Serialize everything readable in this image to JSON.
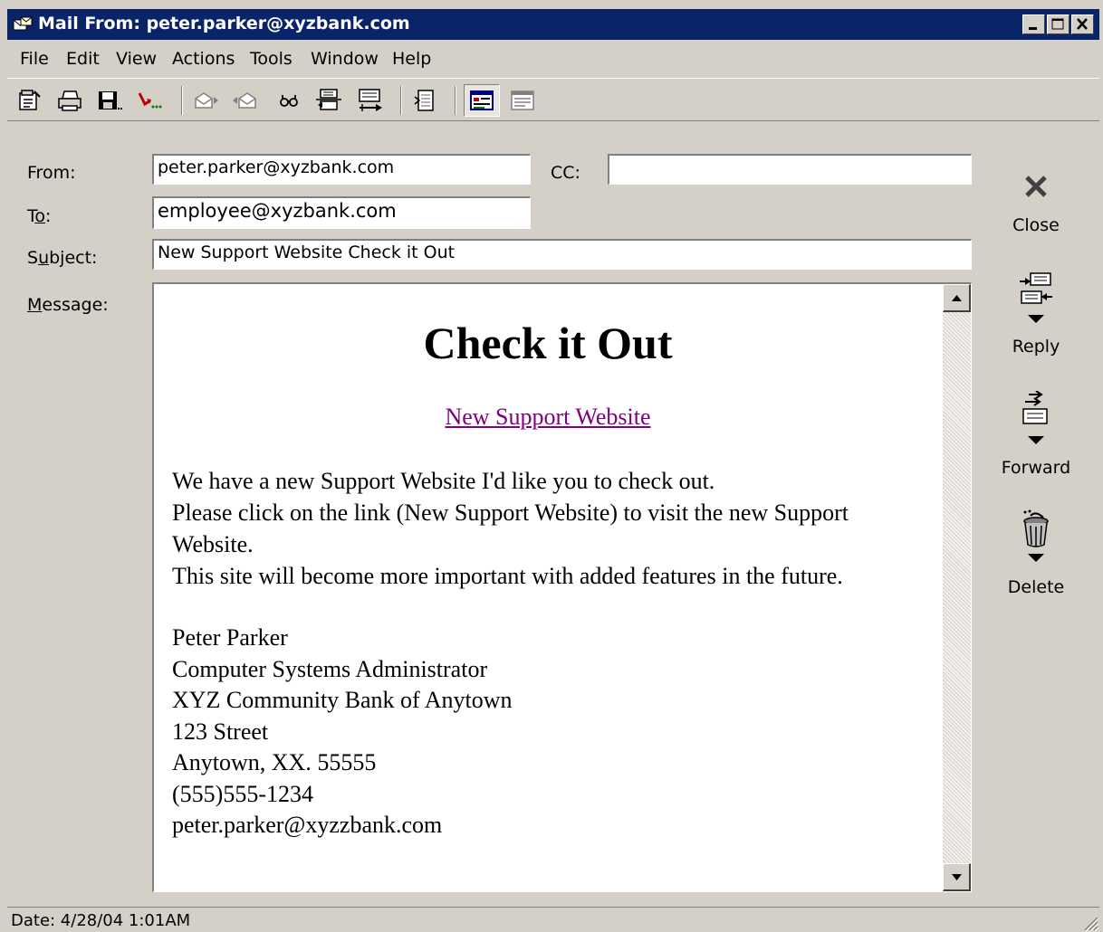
{
  "window": {
    "title": "Mail From: peter.parker@xyzbank.com"
  },
  "menu": [
    "File",
    "Edit",
    "View",
    "Actions",
    "Tools",
    "Window",
    "Help"
  ],
  "toolbar": {
    "icons": [
      "properties-icon",
      "print-icon",
      "save-icon",
      "move-to-folder-icon",
      "previous-item-icon",
      "next-item-icon",
      "find-icon",
      "reply-to-all-icon",
      "forward-icon",
      "address-book-icon",
      "html-view-icon",
      "text-view-icon"
    ]
  },
  "headers": {
    "from_label": "From:",
    "from_value": "peter.parker@xyzbank.com",
    "cc_label": "CC:",
    "cc_value": "",
    "to_label_pre": "T",
    "to_label_ul": "o",
    "to_label_post": ":",
    "to_value": "employee@xyzbank.com",
    "subject_label_pre": "S",
    "subject_label_ul": "u",
    "subject_label_post": "bject:",
    "subject_value": "New Support Website Check it Out",
    "message_label_ul": "M",
    "message_label_post": "essage:"
  },
  "message": {
    "heading": "Check it Out",
    "link_text": "New Support Website",
    "body": [
      "We have a new Support Website I'd like you to check out.",
      "Please click on the link (New Support Website) to visit the new Support Website.",
      "This site will become more important with added features in the future."
    ],
    "signature": [
      "Peter Parker",
      "Computer Systems Administrator",
      "XYZ Community Bank of Anytown",
      "123 Street",
      "Anytown, XX. 55555",
      "(555)555-1234",
      "peter.parker@xyzzbank.com"
    ]
  },
  "actions": {
    "close": "Close",
    "reply": "Reply",
    "forward": "Forward",
    "delete": "Delete"
  },
  "status": {
    "date": "Date: 4/28/04 1:01AM"
  },
  "colors": {
    "titlebar": "#0a246a",
    "chrome": "#d4d0c8",
    "link_visited": "#800080"
  }
}
